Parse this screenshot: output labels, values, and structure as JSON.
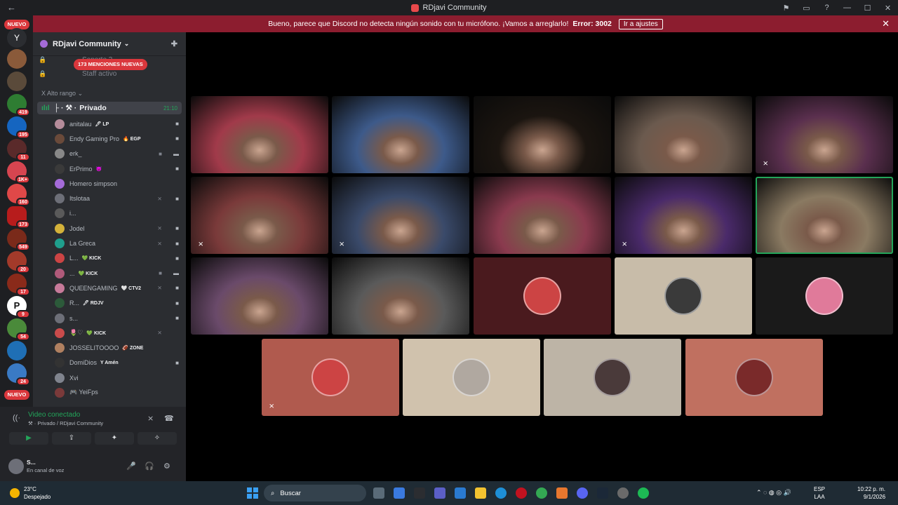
{
  "window": {
    "title": "RDjavi Community",
    "back_glyph": "←",
    "controls": [
      "⚑",
      "▭",
      "?",
      "—",
      "☐",
      "✕"
    ]
  },
  "banner": {
    "message": "Bueno, parece que Discord no detecta ningún sonido con tu micrófono. ¡Vamos a arreglarlo!",
    "error": "Error: 3002",
    "action": "Ir a ajustes",
    "close": "✕"
  },
  "servers": {
    "nuevo_top": "NUEVO",
    "nuevo_bottom": "NUEVO",
    "badges": [
      "419",
      "195",
      "11",
      "1K+",
      "160",
      "173",
      "549",
      "20",
      "17",
      "9",
      "54",
      "24"
    ]
  },
  "guild": {
    "name": "RDjavi Community",
    "chevron": "⌄",
    "invite_icon": "person-add-icon",
    "channel_above_1": "Soporte 3",
    "channel_above_2": "Staff activo",
    "mentions": "173 MENCIONES NUEVAS",
    "category": "X Alto rango",
    "category_chevron": "⌄",
    "active_channel": {
      "prefix": "├ · ⚒ ·",
      "name": "Privado",
      "time": "21:10"
    }
  },
  "members": [
    {
      "name": "anitalau",
      "tag": "🖊 LP",
      "mic": "",
      "cam": "■",
      "color": "#b58c9a"
    },
    {
      "name": "Endy Gaming Pro",
      "tag": "🔥 EGP",
      "mic": "",
      "cam": "■",
      "color": "#6a4a3a"
    },
    {
      "name": "erk_",
      "tag": "",
      "mic": "■",
      "cam": "▬",
      "color": "#888"
    },
    {
      "name": "ErPrimo",
      "tag": "😈",
      "mic": "",
      "cam": "■",
      "color": "#3a3a3a"
    },
    {
      "name": "Homero simpson",
      "tag": "",
      "mic": "",
      "cam": "",
      "color": "#a46bd8"
    },
    {
      "name": "Itslotaa",
      "tag": "",
      "mic": "⨯",
      "cam": "■",
      "color": "#6d6f78"
    },
    {
      "name": "i...",
      "tag": "",
      "mic": "",
      "cam": "",
      "color": "#5a5a5a"
    },
    {
      "name": "Jodel",
      "tag": "",
      "mic": "⨯",
      "cam": "■",
      "color": "#d4b23a"
    },
    {
      "name": "La Greca",
      "tag": "",
      "mic": "⨯",
      "cam": "■",
      "color": "#1f9e8c"
    },
    {
      "name": "L...",
      "tag": "💚 KICK",
      "mic": "",
      "cam": "■",
      "color": "#c44"
    },
    {
      "name": "...",
      "tag": "💚 KICK",
      "mic": "■",
      "cam": "▬",
      "color": "#b05a7a"
    },
    {
      "name": "QUEENGAMING",
      "tag": "🤍 CTV2",
      "mic": "⨯",
      "cam": "■",
      "color": "#c77a9a"
    },
    {
      "name": "R...",
      "tag": "🖊 RDJV",
      "mic": "",
      "cam": "■",
      "color": "#2c5a3a"
    },
    {
      "name": "s...",
      "tag": "",
      "mic": "",
      "cam": "■",
      "color": "#6d6f78"
    },
    {
      "name": "🌷♡",
      "tag": "💚 KICK",
      "mic": "⨯",
      "cam": "",
      "color": "#c94b4b"
    },
    {
      "name": "JOSSELITOOOO",
      "tag": "🏈 ZONE",
      "mic": "",
      "cam": "",
      "color": "#b08060"
    },
    {
      "name": "DomiDios",
      "tag": "Y Amén",
      "mic": "",
      "cam": "■",
      "color": "#333"
    },
    {
      "name": "Xvi",
      "tag": "",
      "mic": "",
      "cam": "",
      "color": "#80848e"
    },
    {
      "name": "🎮 YeiFps",
      "tag": "",
      "mic": "",
      "cam": "",
      "color": "#7a3a3a"
    }
  ],
  "voice": {
    "status": "Video conectado",
    "location": "⚒ · Privado / RDjavi Community",
    "buttons": [
      "▶",
      "⇪",
      "✦",
      "✧"
    ],
    "user": {
      "name": "S...",
      "status": "En canal de voz",
      "controls": [
        "🎤",
        "🎧",
        "⚙"
      ]
    }
  },
  "tiles": [
    {
      "name": "tile-1",
      "color": "#a13a4a",
      "mute": "",
      "kind": "video"
    },
    {
      "name": "tile-2",
      "color": "#3d5a8a",
      "mute": "",
      "kind": "video"
    },
    {
      "name": "tile-3",
      "color": "#1b1510",
      "mute": "",
      "kind": "video"
    },
    {
      "name": "tile-4",
      "color": "#6b5a4e",
      "mute": "",
      "kind": "video"
    },
    {
      "name": "tile-5",
      "color": "#5a2f4e",
      "mute": "⨯",
      "kind": "video"
    },
    {
      "name": "tile-6",
      "color": "#7a3a3a",
      "mute": "⨯",
      "kind": "video"
    },
    {
      "name": "tile-7",
      "color": "#3a4a6a",
      "mute": "⨯",
      "kind": "video"
    },
    {
      "name": "tile-8",
      "color": "#8a3a4e",
      "mute": "",
      "kind": "video"
    },
    {
      "name": "tile-9",
      "color": "#4a2a6a",
      "mute": "⨯",
      "kind": "video"
    },
    {
      "name": "tile-10",
      "color": "#8a7a62",
      "mute": "",
      "kind": "video",
      "speaking": true
    },
    {
      "name": "tile-11",
      "color": "#6a4a6a",
      "mute": "",
      "kind": "video"
    },
    {
      "name": "tile-12",
      "color": "#5a5a5a",
      "mute": "",
      "kind": "video"
    },
    {
      "name": "tile-13",
      "color": "#4a1a1e",
      "mute": "",
      "kind": "avatar",
      "avatar_color": "#c44"
    },
    {
      "name": "tile-14",
      "color": "#c8bca9",
      "mute": "",
      "kind": "avatar",
      "avatar_color": "#3a3a3a"
    },
    {
      "name": "tile-15",
      "color": "#1a1a1a",
      "mute": "",
      "kind": "avatar",
      "avatar_color": "#e07a9a"
    },
    {
      "name": "tile-16",
      "color": "#b05a4e",
      "mute": "⨯",
      "kind": "avatar",
      "avatar_color": "#c44"
    },
    {
      "name": "tile-17",
      "color": "#d0c2ad",
      "mute": "",
      "kind": "avatar",
      "avatar_color": "#b0a8a0"
    },
    {
      "name": "tile-18",
      "color": "#bdb4a6",
      "mute": "",
      "kind": "avatar",
      "avatar_color": "#4a3a3a"
    },
    {
      "name": "tile-19",
      "color": "#c07060",
      "mute": "",
      "kind": "avatar",
      "avatar_color": "#7a2a2a"
    }
  ],
  "taskbar": {
    "temp": "23°C",
    "weather": "Despejado",
    "search": "Buscar",
    "lang1": "ESP",
    "lang2": "LAA",
    "time": "10:22 p. m.",
    "date": "9/1/2026",
    "tray_icons": "⌃  ◌  ◍  ◎  🔊"
  }
}
